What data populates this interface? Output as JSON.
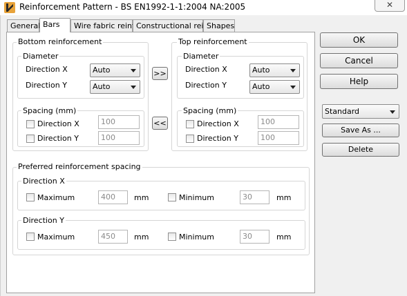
{
  "window": {
    "title": "Reinforcement Pattern - BS EN1992-1-1:2004 NA:2005",
    "close_glyph": "✕"
  },
  "tabs": [
    {
      "label": "General"
    },
    {
      "label": "Bars"
    },
    {
      "label": "Wire fabric reinf."
    },
    {
      "label": "Constructional reinf."
    },
    {
      "label": "Shapes"
    }
  ],
  "bottom": {
    "title": "Bottom reinforcement",
    "diameter_title": "Diameter",
    "dir_x_label": "Direction X",
    "dir_x_value": "Auto",
    "dir_y_label": "Direction Y",
    "dir_y_value": "Auto",
    "spacing_title": "Spacing (mm)",
    "spacing_x_label": "Direction X",
    "spacing_x_value": "100",
    "spacing_y_label": "Direction Y",
    "spacing_y_value": "100"
  },
  "copy": {
    "to_top": ">>",
    "to_bottom": "<<"
  },
  "top": {
    "title": "Top reinforcement",
    "diameter_title": "Diameter",
    "dir_x_label": "Direction X",
    "dir_x_value": "Auto",
    "dir_y_label": "Direction Y",
    "dir_y_value": "Auto",
    "spacing_title": "Spacing (mm)",
    "spacing_x_label": "Direction X",
    "spacing_x_value": "100",
    "spacing_y_label": "Direction Y",
    "spacing_y_value": "100"
  },
  "preferred": {
    "title": "Preferred reinforcement spacing",
    "x": {
      "title": "Direction X",
      "max_label": "Maximum",
      "max_value": "400",
      "max_unit": "mm",
      "min_label": "Minimum",
      "min_value": "30",
      "min_unit": "mm"
    },
    "y": {
      "title": "Direction Y",
      "max_label": "Maximum",
      "max_value": "450",
      "max_unit": "mm",
      "min_label": "Minimum",
      "min_value": "30",
      "min_unit": "mm"
    }
  },
  "side": {
    "ok": "OK",
    "cancel": "Cancel",
    "help": "Help",
    "preset_value": "Standard",
    "save_as": "Save As ...",
    "delete": "Delete"
  }
}
